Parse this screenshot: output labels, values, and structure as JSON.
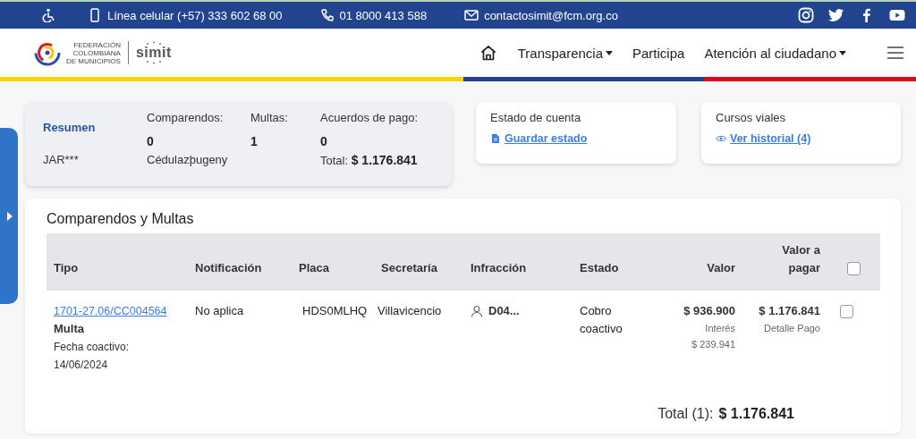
{
  "top_bar": {
    "contacts": [
      {
        "kind": "accessibility"
      },
      {
        "kind": "mobile",
        "text": "Línea celular (+57) 333 602 68 00"
      },
      {
        "kind": "phone",
        "text": "01 8000 413 588"
      },
      {
        "kind": "mail",
        "text": "contactosimit@fcm.org.co"
      }
    ],
    "social": [
      {
        "kind": "instagram"
      },
      {
        "kind": "twitter"
      },
      {
        "kind": "facebook"
      },
      {
        "kind": "youtube"
      }
    ]
  },
  "header": {
    "logo": {
      "org_lines": [
        "FEDERACIÓN",
        "COLOMBIANA",
        "DE MUNICIPIOS"
      ],
      "brand": "simit"
    },
    "nav": [
      {
        "kind": "home"
      },
      {
        "kind": "link",
        "label": "Transparencia",
        "dropdown": true
      },
      {
        "kind": "link",
        "label": "Participa",
        "dropdown": false
      },
      {
        "kind": "link",
        "label": "Atención al ciudadano",
        "dropdown": true
      }
    ]
  },
  "summary": {
    "title": "Resumen",
    "person": "JAR***",
    "stats": [
      {
        "label": "Comparendos:",
        "value": "0",
        "note": "Cédulazþugeny"
      },
      {
        "label": "Multas:",
        "value": "1"
      },
      {
        "label": "Acuerdos de pago:",
        "value": "0",
        "note": "Total: **$ 1.176.841**"
      }
    ]
  },
  "cards": [
    {
      "title": "Estado de cuenta",
      "kind": "document",
      "link": "Guardar estado"
    },
    {
      "title": "Cursos viales",
      "kind": "eye",
      "link": "Ver historial (4)"
    }
  ],
  "fines": {
    "title": "Comparendos y Multas",
    "columns": [
      "Tipo",
      "Notificación",
      "Placa",
      "Secretaría",
      "Infracción",
      "Estado",
      "Valor",
      "Valor a pagar"
    ],
    "select_all": {
      "checked": false
    },
    "rows": [
      {
        "tipo": {
          "link": "1701-27.06/CC004564",
          "type": "Multa",
          "date_label": "Fecha coactivo:",
          "date": "14/06/2024"
        },
        "notificacion": "No aplica",
        "placa": "HDS0MLHQ",
        "secretaria": "Villavicencio",
        "infraccion": "D04...",
        "estado": "Cobro coactivo",
        "valor": {
          "amount": "$ 936.900",
          "label": "Interés",
          "interest": "$ 239.941"
        },
        "pagar": {
          "amount": "$ 1.176.841",
          "label": "Detalle Pago"
        },
        "checked": false
      }
    ],
    "total_label": "Total (1):",
    "total": "$ 1.176.841"
  }
}
